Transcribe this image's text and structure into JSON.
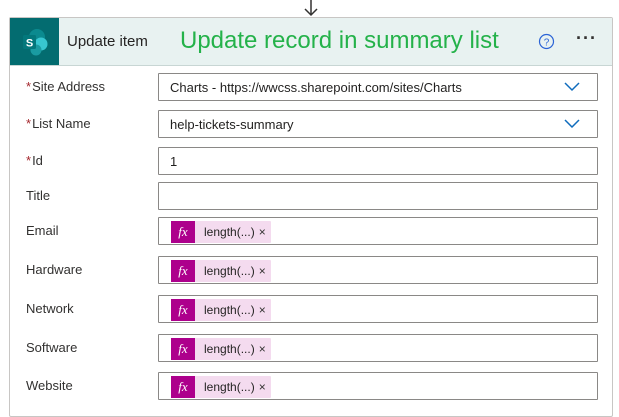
{
  "action": {
    "title": "Update item",
    "annotation": "Update record in summary list",
    "icons": {
      "logo": "sharepoint-icon",
      "help": "help-icon",
      "more": "more-options-icon",
      "arrow": "arrow-down-icon"
    },
    "more_label": "···"
  },
  "fields": {
    "site_address": {
      "label": "Site Address",
      "required_mark": "*",
      "value": "Charts - https://wwcss.sharepoint.com/sites/Charts"
    },
    "list_name": {
      "label": "List Name",
      "required_mark": "*",
      "value": "help-tickets-summary"
    },
    "id": {
      "label": "Id",
      "required_mark": "*",
      "value": "1"
    },
    "title": {
      "label": "Title",
      "value": ""
    },
    "email": {
      "label": "Email",
      "token": "length(...)",
      "remove": "×"
    },
    "hardware": {
      "label": "Hardware",
      "token": "length(...)",
      "remove": "×"
    },
    "network": {
      "label": "Network",
      "token": "length(...)",
      "remove": "×"
    },
    "software": {
      "label": "Software",
      "token": "length(...)",
      "remove": "×"
    },
    "website": {
      "label": "Website",
      "token": "length(...)",
      "remove": "×"
    }
  },
  "expression_icon": "fx",
  "colors": {
    "brand": "#036c70",
    "header_bg": "#e8f2f1",
    "annotation": "#24b24a",
    "token_bg": "#f4dbef",
    "fx_bg": "#ad008c",
    "required": "#a4262c",
    "chevron": "#0f6cbd"
  }
}
